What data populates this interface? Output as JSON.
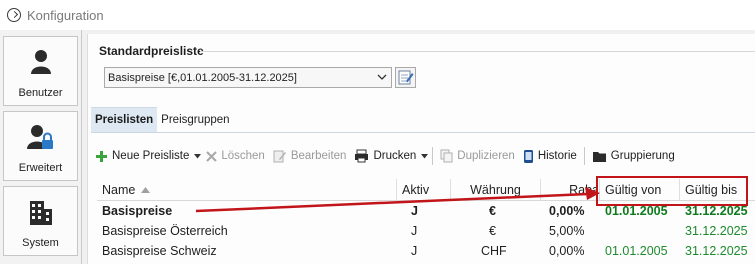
{
  "window": {
    "title": "Konfiguration"
  },
  "sidebar": {
    "items": [
      {
        "label": "Benutzer",
        "icon": "user-icon"
      },
      {
        "label": "Erweitert",
        "icon": "user-lock-icon"
      },
      {
        "label": "System",
        "icon": "building-icon"
      }
    ]
  },
  "standard_pricelist": {
    "group_title": "Standardpreisliste",
    "selected": "Basispreise [€,01.01.2005-31.12.2025]"
  },
  "tabs": [
    {
      "label": "Preislisten",
      "active": true
    },
    {
      "label": "Preisgruppen",
      "active": false
    }
  ],
  "toolbar": {
    "new_label": "Neue Preisliste",
    "delete_label": "Löschen",
    "edit_label": "Bearbeiten",
    "print_label": "Drucken",
    "duplicate_label": "Duplizieren",
    "history_label": "Historie",
    "grouping_label": "Gruppierung"
  },
  "table": {
    "columns": [
      "Name",
      "Aktiv",
      "Währung",
      "Rabatt",
      "Gültig von",
      "Gültig bis"
    ],
    "column_header_visible": {
      "rabatt": "Raba"
    },
    "rows": [
      {
        "name": "Basispreise",
        "aktiv": "J",
        "waehrung": "€",
        "rabatt": "0,00%",
        "von": "01.01.2005",
        "bis": "31.12.2025",
        "bold": true
      },
      {
        "name": "Basispreise Österreich",
        "aktiv": "J",
        "waehrung": "€",
        "rabatt": "5,00%",
        "von": "",
        "bis": "31.12.2025",
        "bold": false
      },
      {
        "name": "Basispreise Schweiz",
        "aktiv": "J",
        "waehrung": "CHF",
        "rabatt": "0,00%",
        "von": "01.01.2005",
        "bis": "31.12.2025",
        "bold": false
      }
    ]
  },
  "colors": {
    "accent": "#dde8f3",
    "valid_date": "#1d8a2d",
    "annotation": "#c2151a"
  }
}
